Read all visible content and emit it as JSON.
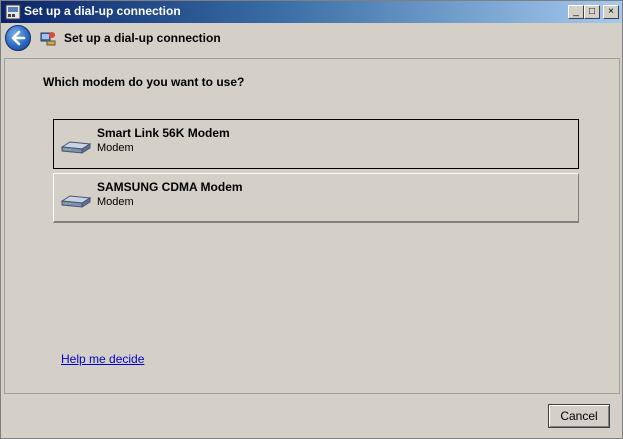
{
  "window": {
    "title": "Set up a dial-up connection",
    "minimize_glyph": "_",
    "maximize_glyph": "□",
    "close_glyph": "×"
  },
  "nav": {
    "back_icon": "back-arrow-icon",
    "title": "Set up a dial-up connection"
  },
  "main": {
    "question": "Which modem do you want to use?",
    "modems": [
      {
        "name": "Smart Link 56K Modem",
        "type": "Modem",
        "icon": "modem-icon",
        "selected": true
      },
      {
        "name": "SAMSUNG CDMA Modem",
        "type": "Modem",
        "icon": "modem-icon",
        "selected": false
      }
    ],
    "help_link": "Help me decide"
  },
  "footer": {
    "cancel_label": "Cancel"
  },
  "colors": {
    "title_bar_start": "#0a246a",
    "title_bar_end": "#a6caf0",
    "face": "#d4d0c8",
    "link": "#0000cc"
  }
}
